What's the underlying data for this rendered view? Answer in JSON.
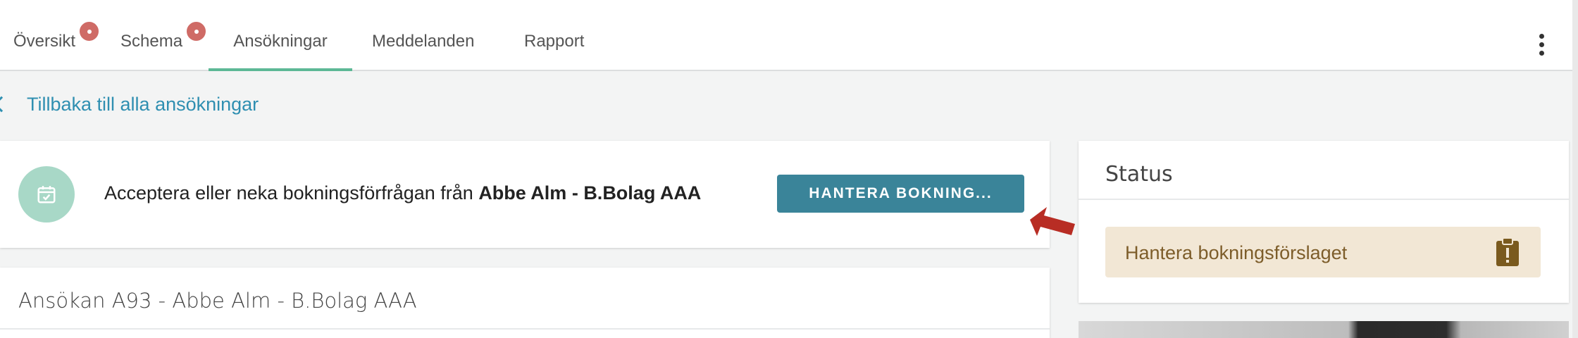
{
  "nav": {
    "tabs": [
      {
        "label": "Översikt",
        "badge": true
      },
      {
        "label": "Schema",
        "badge": true
      },
      {
        "label": "Ansökningar",
        "active": true
      },
      {
        "label": "Meddelanden"
      },
      {
        "label": "Rapport"
      }
    ],
    "menu_icon": "more-vertical-icon"
  },
  "back_link": {
    "label": "Tillbaka till alla ansökningar",
    "icon": "chevron-left-icon"
  },
  "booking": {
    "text_prefix": "Acceptera eller neka bokningsförfrågan från ",
    "text_bold": "Abbe Alm - B.Bolag AAA",
    "button_label": "HANTERA BOKNING...",
    "icon": "calendar-check-icon"
  },
  "application": {
    "title": "Ansökan A93 - Abbe Alm - B.Bolag AAA"
  },
  "status": {
    "title": "Status",
    "item_label": "Hantera bokningsförslaget",
    "item_icon": "clipboard-alert-icon"
  },
  "colors": {
    "accent": "#3a8499",
    "link": "#2f8fb1",
    "active_tab_underline": "#5cb895",
    "badge": "#cf6b66",
    "annotation_arrow": "#b82d24",
    "status_bg": "#f2e7d5"
  }
}
